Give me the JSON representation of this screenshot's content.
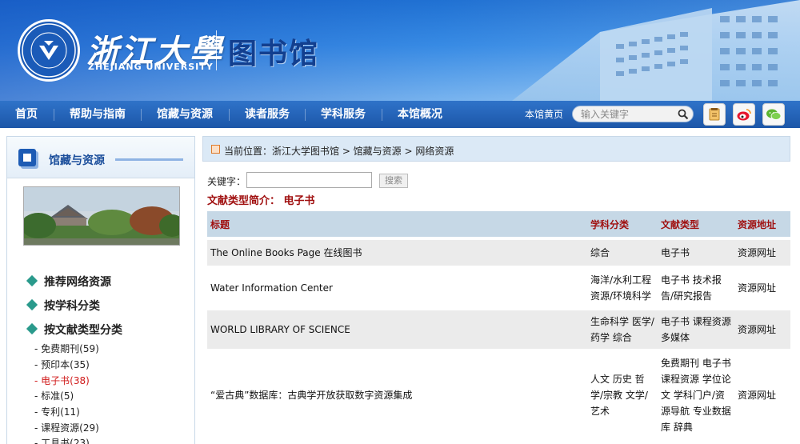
{
  "header": {
    "logo_cn": "浙江大學",
    "logo_en": "ZHEJIANG UNIVERSITY",
    "library_title": "图书馆",
    "emblem_icon": "university-emblem-icon"
  },
  "nav": {
    "items": [
      "首页",
      "帮助与指南",
      "馆藏与资源",
      "读者服务",
      "学科服务",
      "本馆概况"
    ],
    "home_link": "本馆黄页",
    "search_placeholder": "输入关键字",
    "icons": [
      "search-icon",
      "notebook-icon",
      "weibo-icon",
      "wechat-icon"
    ]
  },
  "sidebar": {
    "title": "馆藏与资源",
    "menu": [
      "推荐网络资源",
      "按学科分类",
      "按文献类型分类"
    ],
    "sub_items": [
      {
        "label": "- 免费期刊(59)",
        "active": false
      },
      {
        "label": "- 预印本(35)",
        "active": false
      },
      {
        "label": "- 电子书(38)",
        "active": true
      },
      {
        "label": "- 标准(5)",
        "active": false
      },
      {
        "label": "- 专利(11)",
        "active": false
      },
      {
        "label": "- 课程资源(29)",
        "active": false
      },
      {
        "label": "- 工具书(23)",
        "active": false
      }
    ]
  },
  "main": {
    "breadcrumb": "当前位置：浙江大学图书馆 > 馆藏与资源 > 网络资源",
    "keyword_label": "关键字：",
    "keyword_value": "",
    "search_button": "搜索",
    "intro": "文献类型简介：  电子书",
    "table": {
      "headers": [
        "标题",
        "学科分类",
        "文献类型",
        "资源地址"
      ],
      "rows": [
        {
          "title": "The Online Books Page 在线图书",
          "subject": "综合",
          "type": "电子书",
          "link": "资源网址"
        },
        {
          "title": "Water Information Center",
          "subject": "海洋/水利工程 资源/环境科学",
          "type": "电子书 技术报告/研究报告",
          "link": "资源网址"
        },
        {
          "title": "WORLD LIBRARY OF SCIENCE",
          "subject": "生命科学 医学/药学 综合",
          "type": "电子书 课程资源 多媒体",
          "link": "资源网址"
        },
        {
          "title": "“爱古典”数据库：古典学开放获取数字资源集成",
          "subject": "人文 历史 哲学/宗教 文学/艺术",
          "type": "免费期刊 电子书 课程资源 学位论文 学科门户/资源导航 专业数据库 辞典",
          "link": "资源网址"
        }
      ]
    }
  },
  "colors": {
    "nav_bg": "#1c56a8",
    "header_red": "#a01010",
    "active_red": "#d01a1a",
    "table_header_bg": "#c6d8e6"
  }
}
